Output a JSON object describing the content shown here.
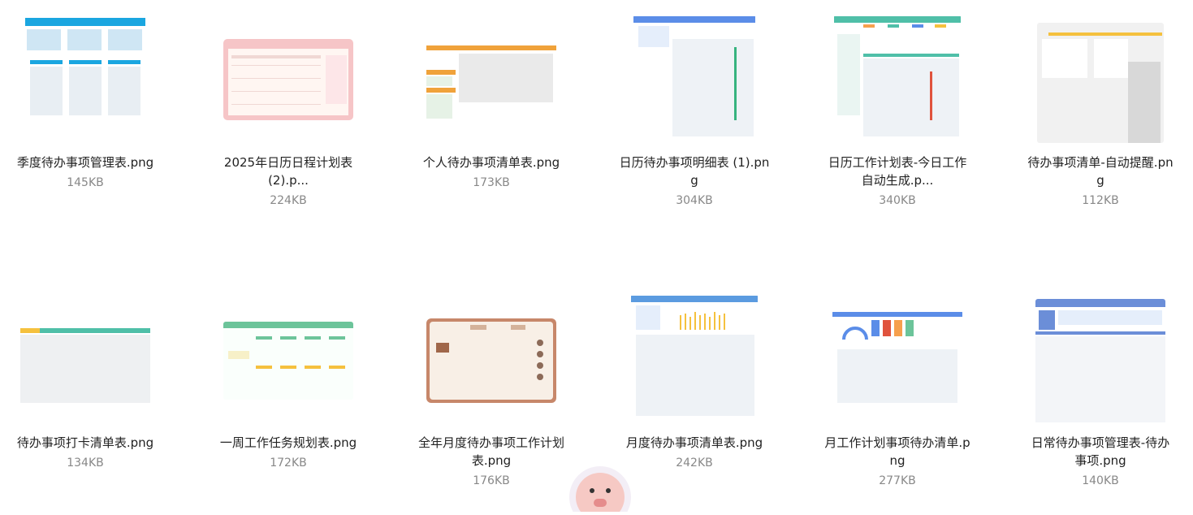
{
  "files": [
    {
      "name_line1": "季度待办事项管理表.png",
      "name_line2": "",
      "size": "145KB",
      "thumb": "blue-calendar"
    },
    {
      "name_line1": "2025年日历日程计划表",
      "name_line2": "(2).p...",
      "size": "224KB",
      "thumb": "pink-planner"
    },
    {
      "name_line1": "个人待办事项清单表.png",
      "name_line2": "",
      "size": "173KB",
      "thumb": "orange-list"
    },
    {
      "name_line1": "日历待办事项明细表 (1).pn",
      "name_line2": "g",
      "size": "304KB",
      "thumb": "blue-detail"
    },
    {
      "name_line1": "日历工作计划表-今日工作",
      "name_line2": "自动生成.p...",
      "size": "340KB",
      "thumb": "teal-dashboard"
    },
    {
      "name_line1": "待办事项清单-自动提醒.pn",
      "name_line2": "g",
      "size": "112KB",
      "thumb": "gray-reminder"
    },
    {
      "name_line1": "待办事项打卡清单表.png",
      "name_line2": "",
      "size": "134KB",
      "thumb": "checkin-sheet"
    },
    {
      "name_line1": "一周工作任务规划表.png",
      "name_line2": "",
      "size": "172KB",
      "thumb": "green-week"
    },
    {
      "name_line1": "全年月度待办事项工作计划",
      "name_line2": "表.png",
      "size": "176KB",
      "thumb": "brown-monthly"
    },
    {
      "name_line1": "月度待办事项清单表.png",
      "name_line2": "",
      "size": "242KB",
      "thumb": "blue-monthly-chart"
    },
    {
      "name_line1": "月工作计划事项待办清单.p",
      "name_line2": "ng",
      "size": "277KB",
      "thumb": "blue-gauge"
    },
    {
      "name_line1": "日常待办事项管理表-待办",
      "name_line2": "事项.png",
      "size": "140KB",
      "thumb": "blue-daily"
    }
  ],
  "colors": {
    "text": "#222222",
    "subtext": "#888888",
    "blue": "#1aa6e0",
    "pink": "#f6c5c7",
    "orange": "#f0a23a",
    "teal": "#4fbfa8",
    "brown": "#a0674a"
  }
}
